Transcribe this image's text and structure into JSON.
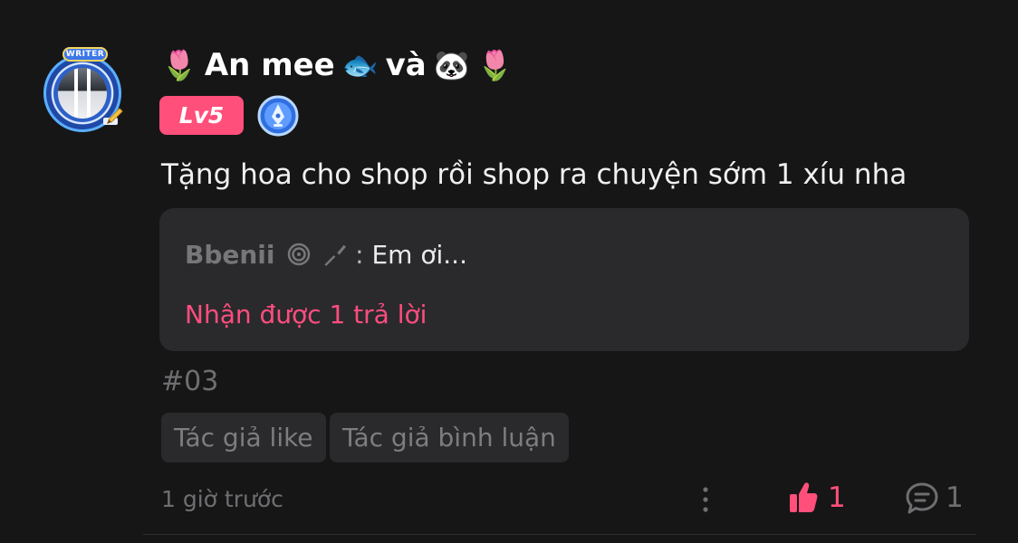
{
  "comment": {
    "author": {
      "name_prefix_icon": "tulip-icon",
      "name_text": "An mee",
      "name_middle_icon": "fish-icon",
      "name_text_2": "và",
      "name_panda_icon": "panda-icon",
      "name_suffix_icon": "tulip-icon",
      "avatar_badge": "WRITER",
      "level": "Lv5",
      "badge_icon": "pen-badge-icon"
    },
    "text": "Tặng hoa cho shop rồi shop ra chuyện sớm 1 xíu nha",
    "reply_preview": {
      "user": "Bbenii",
      "user_icons": "swirl-icon",
      "user_suffix": "⸝ᐟ",
      "separator": ":",
      "message": "Em ơi..."
    },
    "reply_count_label": "Nhận được 1 trả lời",
    "number": "#03",
    "chips": {
      "author_like": "Tác giả like",
      "author_comment": "Tác giả bình luận"
    },
    "time_ago": "1 giờ trước",
    "likes": "1",
    "replies": "1",
    "colors": {
      "background": "#161617",
      "card": "#2a2a2c",
      "accent": "#ff4f7a",
      "muted": "#6f6f72"
    }
  }
}
